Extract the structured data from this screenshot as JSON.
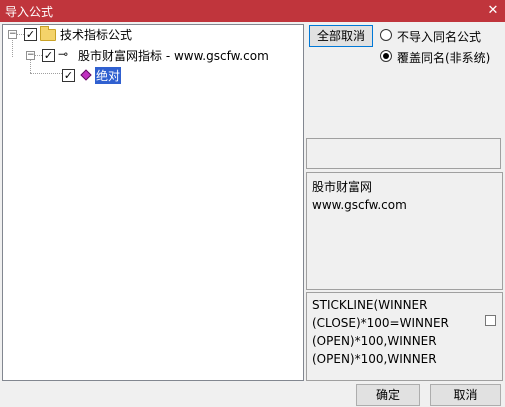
{
  "window": {
    "title": "导入公式",
    "close_glyph": "✕"
  },
  "tree": {
    "root": {
      "label": "技术指标公式",
      "checked": true,
      "expander": "−"
    },
    "child": {
      "label": "股市财富网指标 - www.gscfw.com",
      "checked": true,
      "expander": "−",
      "icon_glyph": "⊸"
    },
    "leaf": {
      "label": "绝对",
      "checked": true,
      "selected": true
    }
  },
  "options": {
    "cancel_all_label": "全部取消",
    "radio1_label": "不导入同名公式",
    "radio2_label": "覆盖同名(非系统)",
    "selected_radio": "radio2"
  },
  "info_panel": {
    "text": "股市财富网\nwww.gscfw.com"
  },
  "formula_panel": {
    "text": "STICKLINE(WINNER\n(CLOSE)*100=WINNER\n(OPEN)*100,WINNER\n(OPEN)*100,WINNER"
  },
  "footer": {
    "ok_label": "确定",
    "cancel_label": "取消"
  },
  "colors": {
    "titlebar": "#c0353c",
    "selection": "#3060d0",
    "folder": "#f4d36a",
    "diamond": "#c030c0"
  },
  "icons": {
    "folder": "folder-icon",
    "key": "key-icon",
    "diamond": "diamond-icon",
    "close": "close-icon"
  }
}
